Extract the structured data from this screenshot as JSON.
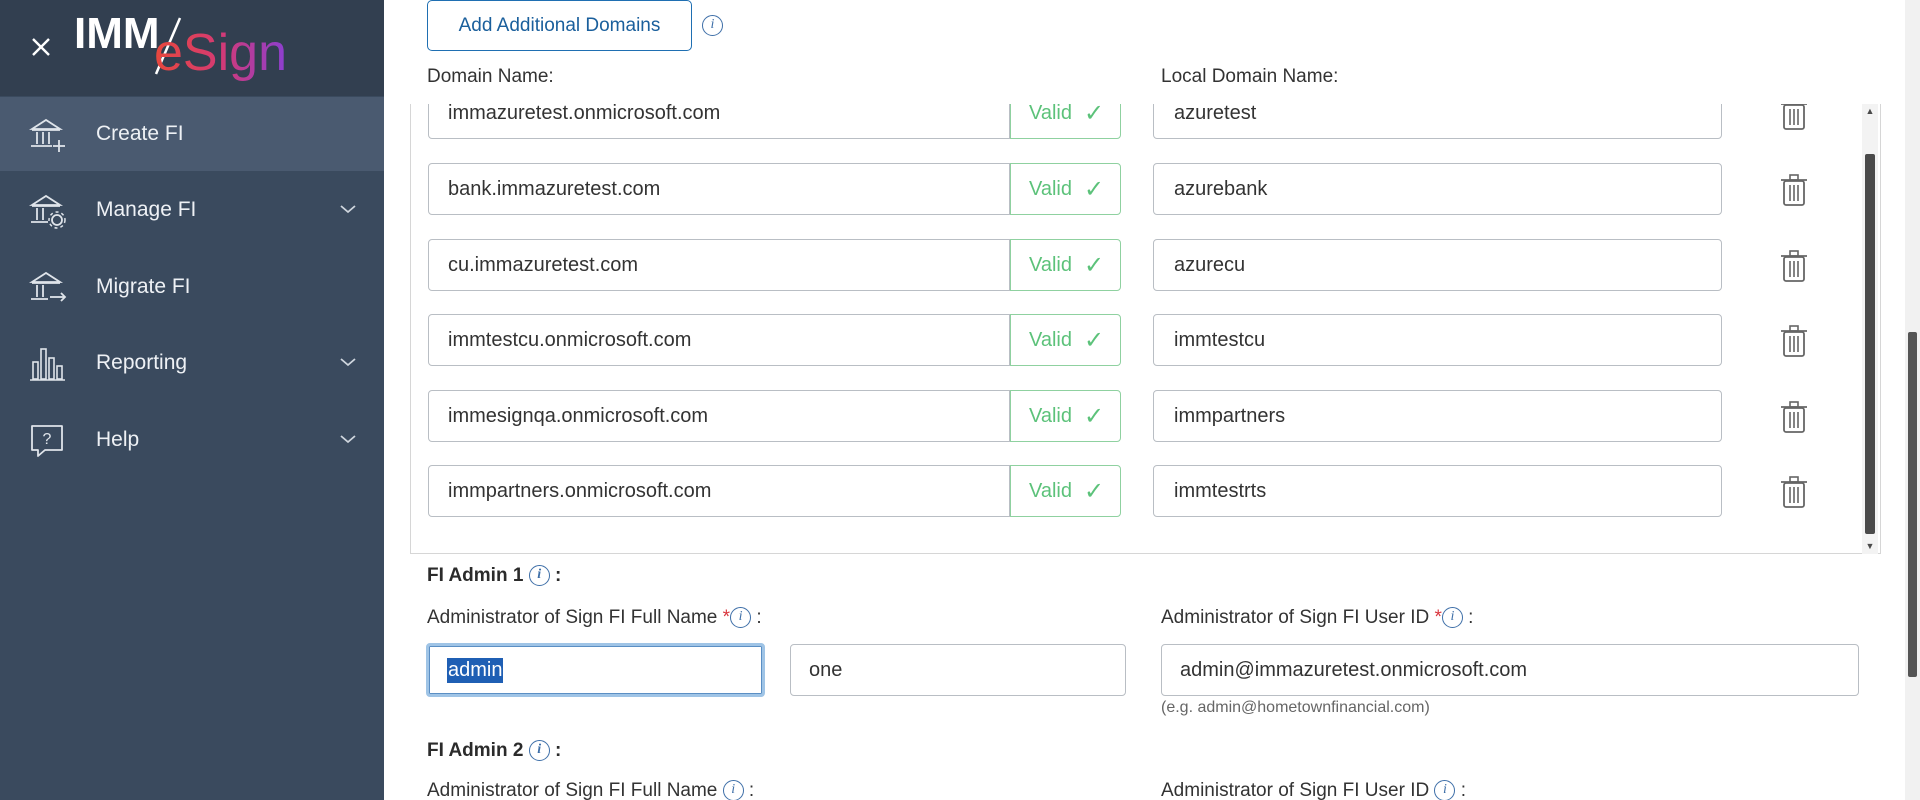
{
  "sidebar": {
    "logo_text": "IMM eSign",
    "items": [
      {
        "label": "Create FI",
        "icon": "bank-add-icon"
      },
      {
        "label": "Manage FI",
        "icon": "bank-gear-icon"
      },
      {
        "label": "Migrate FI",
        "icon": "bank-arrow-icon"
      },
      {
        "label": "Reporting",
        "icon": "bar-chart-icon"
      },
      {
        "label": "Help",
        "icon": "help-bubble-icon"
      }
    ]
  },
  "main": {
    "add_domains_label": "Add Additional Domains",
    "domain_name_label": "Domain Name:",
    "local_domain_label": "Local Domain Name:",
    "valid_label": "Valid",
    "domains": [
      {
        "domain": "immazuretest.onmicrosoft.com",
        "local": "azuretest"
      },
      {
        "domain": "bank.immazuretest.com",
        "local": "azurebank"
      },
      {
        "domain": "cu.immazuretest.com",
        "local": "azurecu"
      },
      {
        "domain": "immtestcu.onmicrosoft.com",
        "local": "immtestcu"
      },
      {
        "domain": "immesignqa.onmicrosoft.com",
        "local": "immpartners"
      },
      {
        "domain": "immpartners.onmicrosoft.com",
        "local": "immtestrts"
      }
    ],
    "admin1": {
      "title": "FI Admin 1",
      "full_name_label": "Administrator of Sign FI Full Name",
      "user_id_label": "Administrator of Sign FI User ID",
      "first_name": "admin",
      "last_name": "one",
      "user_id": "admin@immazuretest.onmicrosoft.com",
      "user_id_hint": "(e.g. admin@hometownfinancial.com)"
    },
    "admin2": {
      "title": "FI Admin 2",
      "full_name_label": "Administrator of Sign FI Full Name",
      "user_id_label": "Administrator of Sign FI User ID"
    }
  },
  "colors": {
    "sidebar_bg": "#3a4a5e",
    "accent": "#1f6fb2",
    "valid_green": "#5cc27a",
    "required_red": "#d9363e"
  }
}
